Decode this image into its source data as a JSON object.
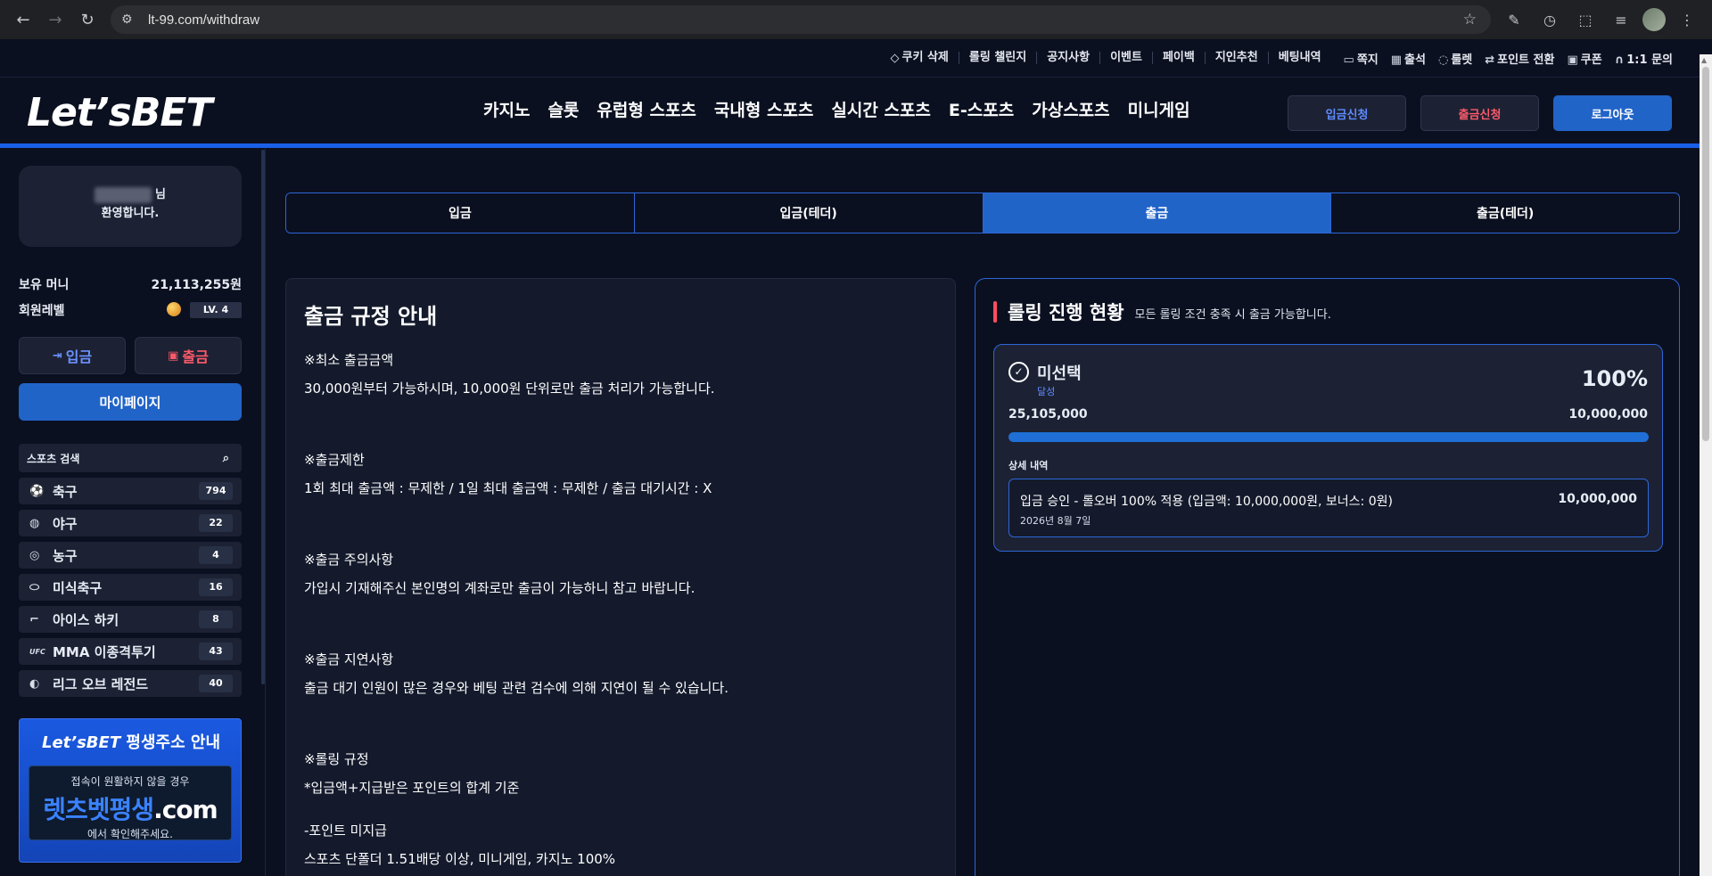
{
  "browser": {
    "url": "lt-99.com/withdraw"
  },
  "utility": {
    "left_items": [
      "쿠키 삭제",
      "롤링 챌린지",
      "공지사항",
      "이벤트",
      "페이백",
      "지인추천",
      "베팅내역"
    ],
    "right_items": [
      {
        "icon": "message-icon",
        "glyph": "▭",
        "label": "쪽지"
      },
      {
        "icon": "calendar-icon",
        "glyph": "▦",
        "label": "출석"
      },
      {
        "icon": "roulette-icon",
        "glyph": "◌",
        "label": "룰렛"
      },
      {
        "icon": "transfer-icon",
        "glyph": "⇄",
        "label": "포인트 전환"
      },
      {
        "icon": "coupon-icon",
        "glyph": "▣",
        "label": "쿠폰"
      },
      {
        "icon": "headset-icon",
        "glyph": "∩",
        "label": "1:1 문의"
      }
    ]
  },
  "header": {
    "logo": "Let’sBET",
    "nav": [
      "카지노",
      "슬롯",
      "유럽형 스포츠",
      "국내형 스포츠",
      "실시간 스포츠",
      "E-스포츠",
      "가상스포츠",
      "미니게임"
    ],
    "deposit_request": "입금신청",
    "withdraw_request": "출금신청",
    "logout": "로그아웃"
  },
  "sidebar": {
    "welcome_suffix": "님",
    "welcome_text": "환영합니다.",
    "money_label": "보유 머니",
    "money_value": "21,113,255원",
    "level_label": "회원레벨",
    "level_value": "LV. 4",
    "deposit_button": "입금",
    "withdraw_button": "출금",
    "mypage_button": "마이페이지",
    "sport_search": "스포츠 검색",
    "sports": [
      {
        "icon": "soccer-icon",
        "glyph": "⚽",
        "name": "축구",
        "count": "794"
      },
      {
        "icon": "baseball-icon",
        "glyph": "◍",
        "name": "야구",
        "count": "22"
      },
      {
        "icon": "basketball-icon",
        "glyph": "◎",
        "name": "농구",
        "count": "4"
      },
      {
        "icon": "football-icon",
        "glyph": "⬭",
        "name": "미식축구",
        "count": "16"
      },
      {
        "icon": "hockey-icon",
        "glyph": "⌐",
        "name": "아이스 하키",
        "count": "8"
      },
      {
        "icon": "ufc-icon",
        "glyph": "UFC",
        "name": "MMA 이종격투기",
        "count": "43"
      },
      {
        "icon": "lol-icon",
        "glyph": "◐",
        "name": "리그 오브 레전드",
        "count": "40"
      }
    ],
    "banner": {
      "logo": "Let’sBET",
      "title": "평생주소 안내",
      "line1": "접속이 원활하지 않을 경우",
      "domain_main": "렛츠벳평생",
      "domain_tld": ".com",
      "line3": "에서 확인해주세요."
    }
  },
  "tabs": [
    {
      "label": "입금",
      "active": false
    },
    {
      "label": "입금(테더)",
      "active": false
    },
    {
      "label": "출금",
      "active": true
    },
    {
      "label": "출금(테더)",
      "active": false
    }
  ],
  "rules": {
    "title": "출금 규정 안내",
    "min_title": "※최소 출금금액",
    "min_text": "30,000원부터 가능하시며, 10,000원 단위로만 출금 처리가 가능합니다.",
    "limit_title": "※출금제한",
    "limit_text": "1회 최대 출금액 : 무제한 / 1일 최대 출금액 : 무제한 / 출금 대기시간 : X",
    "caution_title": "※출금 주의사항",
    "caution_text": "가입시 기재해주신 본인명의 계좌로만 출금이 가능하니 참고 바랍니다.",
    "delay_title": "※출금 지연사항",
    "delay_text": "출금 대기 인원이 많은 경우와 베팅 관련 검수에 의해 지연이 될 수 있습니다.",
    "rolling_title": "※롤링 규정",
    "rolling_text": "*입금액+지급받은 포인트의 합계 기준",
    "no_point_title": "-포인트 미지급",
    "no_point_text": "스포츠 단폴더 1.51배당 이상, 미니게임, 카지노 100%"
  },
  "rolling": {
    "title": "롤링 진행 현황",
    "subtitle": "모든 롤링 조건 충족 시 출금 가능합니다.",
    "item_name": "미선택",
    "status": "달성",
    "percent_text": "100%",
    "progress": 1.0,
    "current": "25,105,000",
    "target": "10,000,000",
    "detail_label": "상세 내역",
    "detail_text": "입금 승인 - 롤오버 100% 적용 (입금액: 10,000,000원, 보너스: 0원)",
    "detail_date": "2026년 8월 7일",
    "detail_amount": "10,000,000"
  },
  "colors": {
    "accent": "#2164c8",
    "highlight_line": "#1a5fe8",
    "danger": "#ff5a6a",
    "background": "#0b1020"
  }
}
